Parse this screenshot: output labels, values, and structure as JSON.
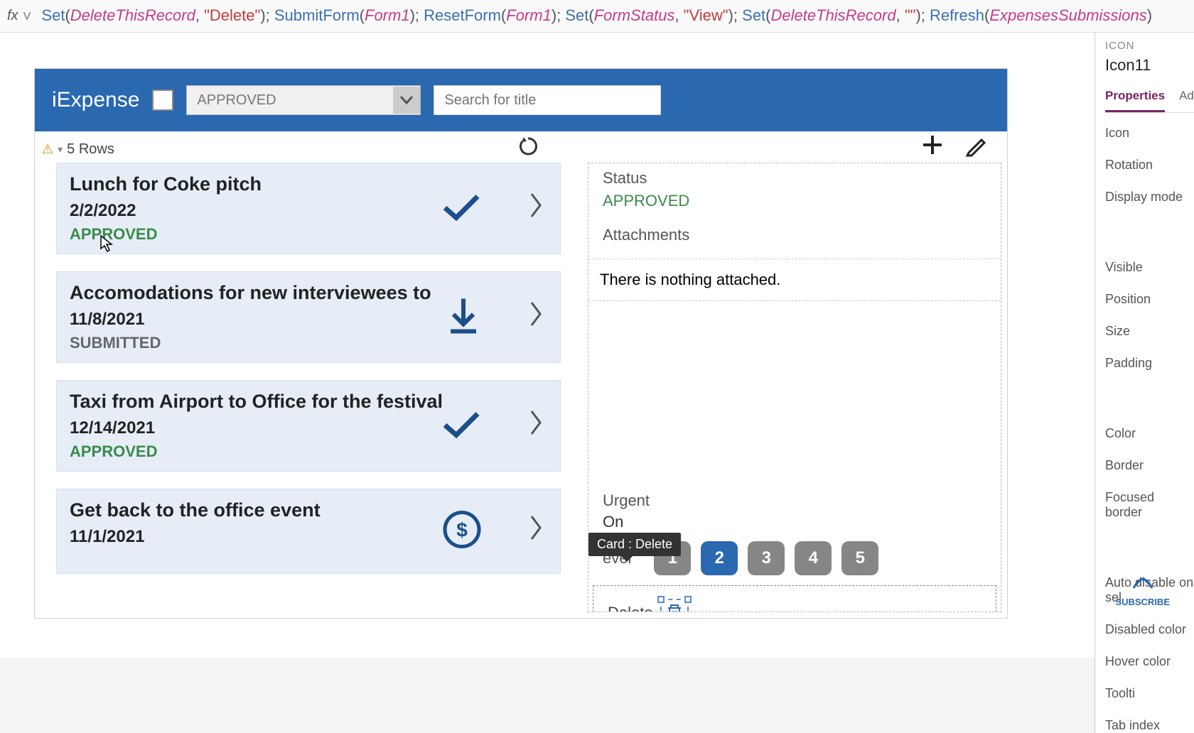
{
  "formula": {
    "tokens": [
      {
        "t": "fn",
        "v": "Set"
      },
      {
        "t": "punc",
        "v": "("
      },
      {
        "t": "id",
        "v": "DeleteThisRecord"
      },
      {
        "t": "punc",
        "v": ", "
      },
      {
        "t": "str",
        "v": "\"Delete\""
      },
      {
        "t": "punc",
        "v": "); "
      },
      {
        "t": "fn",
        "v": "SubmitForm"
      },
      {
        "t": "punc",
        "v": "("
      },
      {
        "t": "id",
        "v": "Form1"
      },
      {
        "t": "punc",
        "v": "); "
      },
      {
        "t": "fn",
        "v": "ResetForm"
      },
      {
        "t": "punc",
        "v": "("
      },
      {
        "t": "id",
        "v": "Form1"
      },
      {
        "t": "punc",
        "v": "); "
      },
      {
        "t": "fn",
        "v": "Set"
      },
      {
        "t": "punc",
        "v": "("
      },
      {
        "t": "id",
        "v": "FormStatus"
      },
      {
        "t": "punc",
        "v": ", "
      },
      {
        "t": "str",
        "v": "\"View\""
      },
      {
        "t": "punc",
        "v": "); "
      },
      {
        "t": "fn",
        "v": "Set"
      },
      {
        "t": "punc",
        "v": "("
      },
      {
        "t": "id",
        "v": "DeleteThisRecord"
      },
      {
        "t": "punc",
        "v": ", "
      },
      {
        "t": "str",
        "v": "\"\""
      },
      {
        "t": "punc",
        "v": "); "
      },
      {
        "t": "fn",
        "v": "Refresh"
      },
      {
        "t": "punc",
        "v": "("
      },
      {
        "t": "id",
        "v": "ExpensesSubmissions"
      },
      {
        "t": "punc",
        "v": ")"
      }
    ]
  },
  "header": {
    "app_title": "iExpense",
    "filter_text": "APPROVED",
    "search_placeholder": "Search for title"
  },
  "list": {
    "row_summary": "5 Rows",
    "items": [
      {
        "title": "Lunch for Coke pitch",
        "date": "2/2/2022",
        "status": "APPROVED",
        "status_class": "st-approved",
        "icon": "check"
      },
      {
        "title": "Accomodations for new interviewees to",
        "date": "11/8/2021",
        "status": "SUBMITTED",
        "status_class": "st-submitted",
        "icon": "download"
      },
      {
        "title": "Taxi from Airport to Office for the festival",
        "date": "12/14/2021",
        "status": "APPROVED",
        "status_class": "st-approved",
        "icon": "check"
      },
      {
        "title": "Get back to the office event",
        "date": "11/1/2021",
        "status": "",
        "status_class": "",
        "icon": "dollar"
      }
    ]
  },
  "detail": {
    "status_label": "Status",
    "status_value": "APPROVED",
    "attachments_label": "Attachments",
    "attachments_value": "There is nothing attached.",
    "urgent_label": "Urgent",
    "urgent_value": "On",
    "level_label": "evel",
    "levels": [
      "1",
      "2",
      "3",
      "4",
      "5"
    ],
    "active_level": "2",
    "tooltip": "Card : Delete",
    "delete_label": "Delete"
  },
  "properties": {
    "section": "ICON",
    "control_name": "Icon11",
    "tabs": [
      "Properties",
      "Adva"
    ],
    "rows_group1": [
      "Icon",
      "Rotation",
      "Display mode"
    ],
    "rows_group2": [
      "Visible",
      "Position",
      "Size",
      "Padding"
    ],
    "rows_group3": [
      "Color",
      "Border",
      "Focused border"
    ],
    "rows_group4": [
      "Auto disable on sel",
      "Disabled color",
      "Hover color",
      "Toolti",
      "Tab index"
    ]
  },
  "subscribe": "SUBSCRIBE"
}
